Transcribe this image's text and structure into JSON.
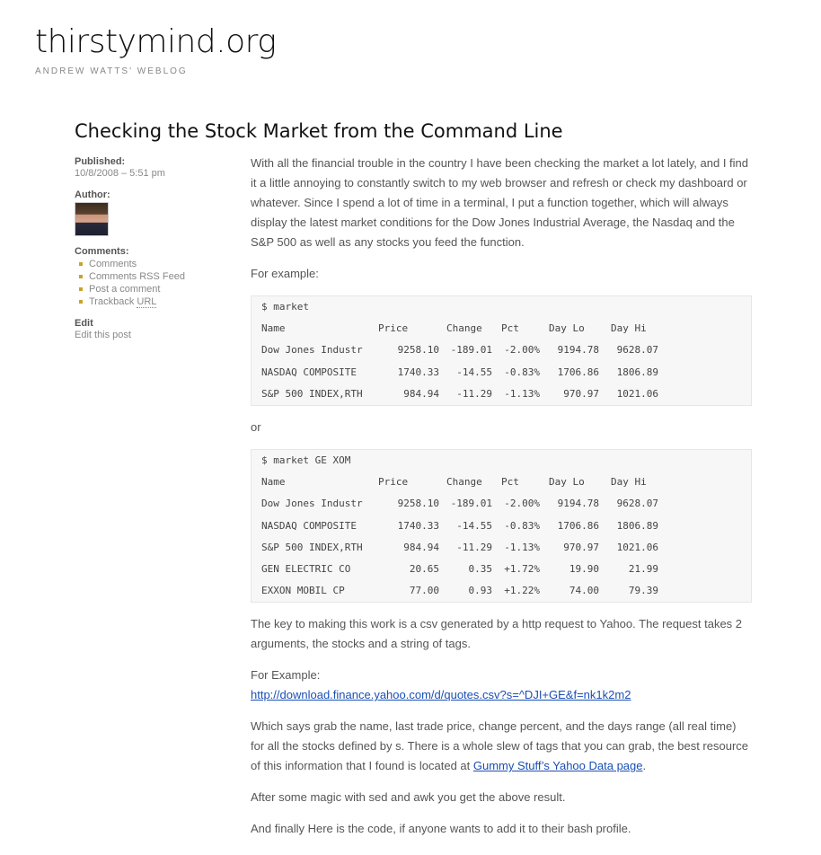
{
  "site": {
    "title": "thirstymind.org",
    "description": "ANDREW WATTS' WEBLOG"
  },
  "post": {
    "title": "Checking the Stock Market from the Command Line"
  },
  "meta": {
    "published_label": "Published:",
    "published_value": "10/8/2008 – 5:51 pm",
    "author_label": "Author:",
    "comments_label": "Comments:",
    "comment_links": [
      "Comments",
      "Comments RSS Feed",
      "Post a comment"
    ],
    "trackback_prefix": "Trackback ",
    "trackback_abbr": "URL",
    "edit_label": "Edit",
    "edit_link": "Edit this post"
  },
  "content": {
    "para1": "With all the financial trouble in the country I have been checking the market a lot lately, and I find it a little annoying to constantly switch to my web browser and refresh or check my dashboard or whatever. Since I spend a lot of time in a terminal, I put a function together, which will always display the latest market conditions for the Dow Jones Industrial Average, the Nasdaq and the S&P 500 as well as any stocks you feed the function.",
    "for_example": "For example:",
    "or": "or",
    "para2": "The key to making this work is a csv generated by a http request to Yahoo. The request takes 2 arguments, the stocks and a string of tags.",
    "for_example2": "For Example:",
    "yahoo_url": "http://download.finance.yahoo.com/d/quotes.csv?s=^DJI+GE&f=nk1k2m2",
    "para3_before": "Which says grab the name, last trade price, change percent, and the days range (all real time) for all the stocks defined by s. There is a whole slew of tags that you can grab, the best resource of this information that I found is located at ",
    "para3_link": "Gummy Stuff’s Yahoo Data page",
    "para3_after": ".",
    "para4": "After some magic with sed and awk you get the above result.",
    "para5": "And finally Here is the code, if anyone wants to add it to their bash profile."
  },
  "headers": {
    "name": "Name",
    "price": "Price",
    "change": "Change",
    "pct": "Pct",
    "day_lo": "Day Lo",
    "day_hi": "Day Hi"
  },
  "code1": {
    "command": "$ market",
    "rows": [
      {
        "name": "Dow Jones Industr",
        "price": "9258.10",
        "change": "-189.01",
        "pct": "-2.00%",
        "lo": "9194.78",
        "hi": "9628.07"
      },
      {
        "name": "NASDAQ COMPOSITE",
        "price": "1740.33",
        "change": "-14.55",
        "pct": "-0.83%",
        "lo": "1706.86",
        "hi": "1806.89"
      },
      {
        "name": "S&P 500 INDEX,RTH",
        "price": "984.94",
        "change": "-11.29",
        "pct": "-1.13%",
        "lo": "970.97",
        "hi": "1021.06"
      }
    ]
  },
  "code2": {
    "command": "$ market GE XOM",
    "rows": [
      {
        "name": "Dow Jones Industr",
        "price": "9258.10",
        "change": "-189.01",
        "pct": "-2.00%",
        "lo": "9194.78",
        "hi": "9628.07"
      },
      {
        "name": "NASDAQ COMPOSITE",
        "price": "1740.33",
        "change": "-14.55",
        "pct": "-0.83%",
        "lo": "1706.86",
        "hi": "1806.89"
      },
      {
        "name": "S&P 500 INDEX,RTH",
        "price": "984.94",
        "change": "-11.29",
        "pct": "-1.13%",
        "lo": "970.97",
        "hi": "1021.06"
      },
      {
        "name": "GEN ELECTRIC CO",
        "price": "20.65",
        "change": "0.35",
        "pct": "+1.72%",
        "lo": "19.90",
        "hi": "21.99"
      },
      {
        "name": "EXXON MOBIL CP",
        "price": "77.00",
        "change": "0.93",
        "pct": "+1.22%",
        "lo": "74.00",
        "hi": "79.39"
      }
    ]
  }
}
